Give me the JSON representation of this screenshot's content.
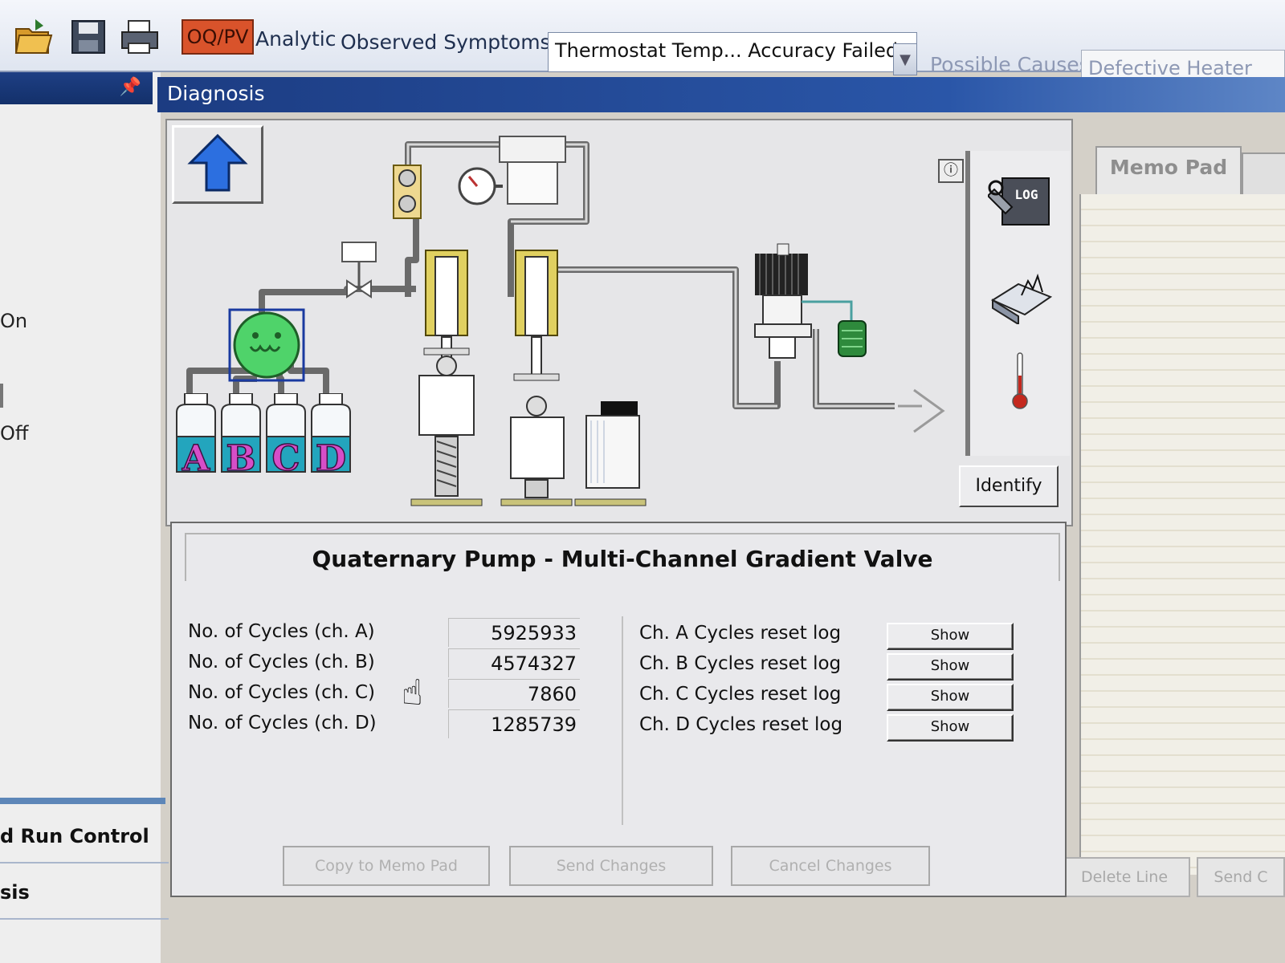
{
  "toolbar": {
    "oqpv_label": "OQ/PV",
    "analytic_label": "Analytic",
    "observed_symptoms_label": "Observed Symptoms",
    "symptom_value": "Thermostat Temp... Accuracy Failed",
    "possible_causes_label": "Possible Causes",
    "cause_value": "Defective Heater"
  },
  "left": {
    "on_text": "On",
    "off_text": "Off",
    "run_control": "d Run Control",
    "sis_text": "sis"
  },
  "diagnosis": {
    "title": "Diagnosis",
    "bottles": [
      "A",
      "B",
      "C",
      "D"
    ],
    "log_icon_text": "LOG",
    "identify_label": "Identify"
  },
  "memo": {
    "tab_label": "Memo Pad",
    "delete_line": "Delete Line",
    "send": "Send C"
  },
  "panel": {
    "title": "Quaternary Pump - Multi-Channel Gradient Valve",
    "rows": [
      {
        "label": "No. of Cycles (ch. A)",
        "value": "5925933",
        "log": "Ch. A Cycles reset log",
        "button": "Show"
      },
      {
        "label": "No. of Cycles (ch. B)",
        "value": "4574327",
        "log": "Ch. B Cycles reset log",
        "button": "Show"
      },
      {
        "label": "No. of Cycles (ch. C)",
        "value": "7860",
        "log": "Ch. C Cycles reset log",
        "button": "Show"
      },
      {
        "label": "No. of Cycles (ch. D)",
        "value": "1285739",
        "log": "Ch. D Cycles reset log",
        "button": "Show"
      }
    ],
    "copy_button": "Copy to Memo Pad",
    "send_button": "Send Changes",
    "cancel_button": "Cancel Changes"
  },
  "colors": {
    "header_blue": "#1c3c82",
    "oqpv_red": "#d9532b",
    "solvent_green": "#4fd36a",
    "bottle_label_pink": "#d64ec8"
  }
}
